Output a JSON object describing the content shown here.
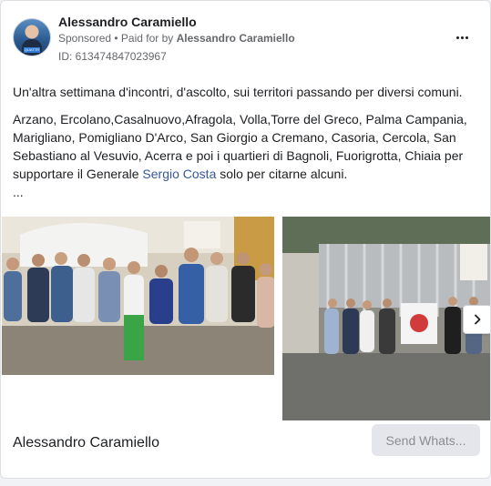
{
  "post": {
    "page_name": "Alessandro Caramiello",
    "sponsored_label": "Sponsored",
    "paid_for_prefix": " • Paid for by ",
    "paid_for_by": "Alessandro Caramiello",
    "ad_id": "ID: 613474847023967",
    "avatar_tag": "QUATTR",
    "paragraph_1": "Un'altra settimana d'incontri, d'ascolto, sui territori passando per diversi comuni.",
    "paragraph_2_start": "Arzano, Ercolano,Casalnuovo,Afragola, Volla,Torre del Greco, Palma Campania, Marigliano, Pomigliano D'Arco, San Giorgio a Cremano, Casoria, Cercola, San Sebastiano al Vesuvio, Acerra e poi i quartieri di Bagnoli, Fuorigrotta, Chiaia per supportare il Generale ",
    "mention": "Sergio Costa",
    "paragraph_2_end": " solo per citarne alcuni.",
    "truncation": "..."
  },
  "carousel": {
    "image_1": "Group photo of people standing outdoors",
    "image_2": "Group of people in front of a fence with a flag",
    "next_icon": "chevron-right-icon"
  },
  "footer": {
    "name": "Alessandro Caramiello",
    "cta_label": "Send Whats..."
  },
  "colors": {
    "link": "#385898",
    "text": "#1c1e21",
    "muted": "#65676b",
    "cta_bg": "#e4e6eb"
  }
}
